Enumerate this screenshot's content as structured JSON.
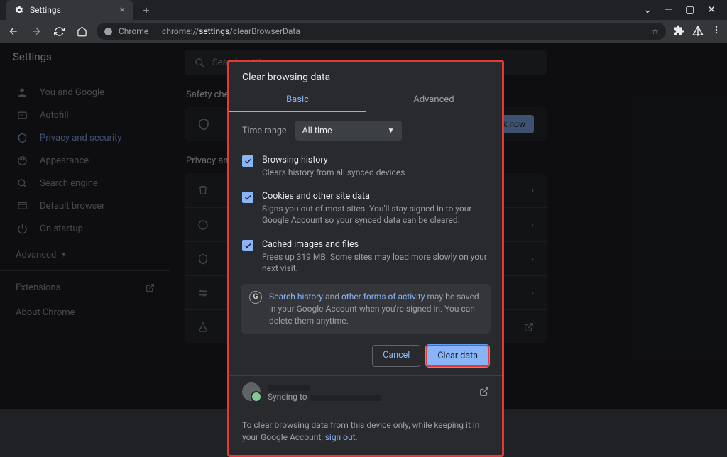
{
  "window": {
    "tab_title": "Settings"
  },
  "omnibox": {
    "origin_label": "Chrome",
    "url_prefix": "chrome://",
    "url_bold": "settings",
    "url_rest": "/clearBrowserData"
  },
  "settings": {
    "title": "Settings",
    "search_placeholder": "Search settings"
  },
  "sidebar": {
    "items": [
      {
        "label": "You and Google"
      },
      {
        "label": "Autofill"
      },
      {
        "label": "Privacy and security"
      },
      {
        "label": "Appearance"
      },
      {
        "label": "Search engine"
      },
      {
        "label": "Default browser"
      },
      {
        "label": "On startup"
      }
    ],
    "advanced_label": "Advanced",
    "extensions_label": "Extensions",
    "about_label": "About Chrome"
  },
  "content": {
    "safety_label": "Safety check",
    "check_now_label": "Check now",
    "privacy_label": "Privacy and security"
  },
  "modal": {
    "title": "Clear browsing data",
    "tab_basic": "Basic",
    "tab_advanced": "Advanced",
    "time_range_label": "Time range",
    "time_range_value": "All time",
    "options": [
      {
        "checked": true,
        "title": "Browsing history",
        "desc": "Clears history from all synced devices"
      },
      {
        "checked": true,
        "title": "Cookies and other site data",
        "desc": "Signs you out of most sites. You'll stay signed in to your Google Account so your synced data can be cleared."
      },
      {
        "checked": true,
        "title": "Cached images and files",
        "desc": "Frees up 319 MB. Some sites may load more slowly on your next visit."
      }
    ],
    "info": {
      "link1": "Search history",
      "mid1": " and ",
      "link2": "other forms of activity",
      "rest": " may be saved in your Google Account when you're signed in. You can delete them anytime."
    },
    "cancel_label": "Cancel",
    "clear_label": "Clear data",
    "syncing_label": "Syncing to",
    "footer_text": "To clear browsing data from this device only, while keeping it in your Google Account, ",
    "footer_link": "sign out",
    "footer_period": "."
  }
}
